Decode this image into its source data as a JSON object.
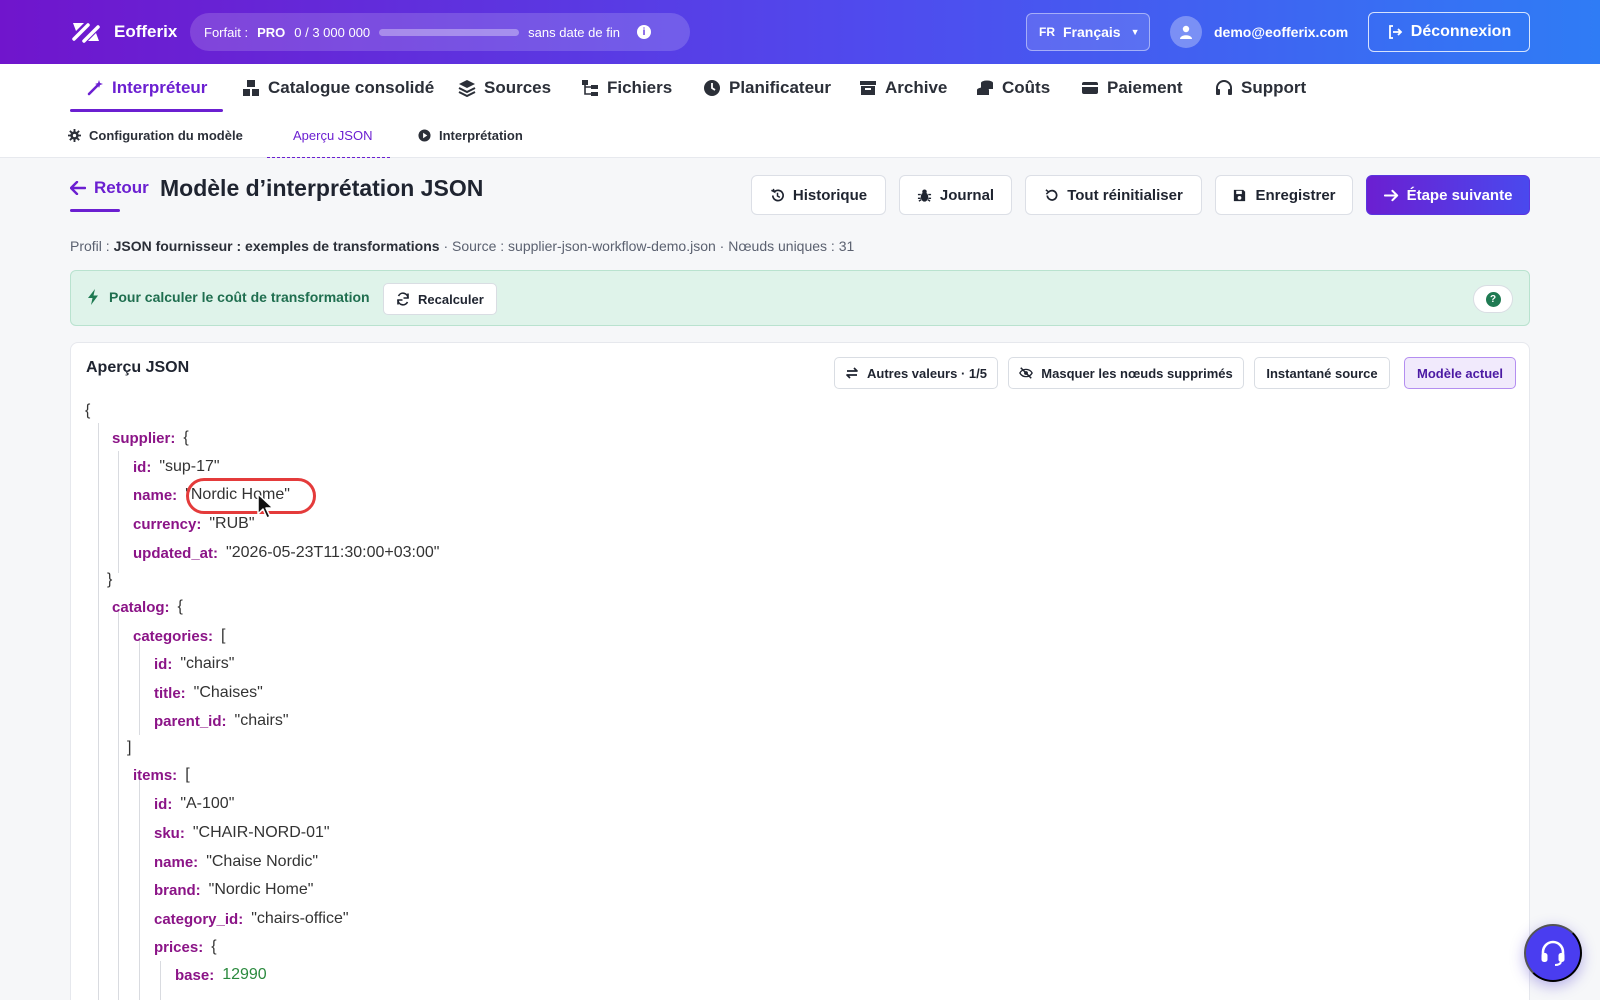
{
  "app": {
    "name": "Eofferix"
  },
  "plan": {
    "label": "Forfait :",
    "tier": "PRO",
    "usage": "0 / 3 000 000",
    "usage_fraction": 0,
    "expiry": "sans date de fin",
    "info_icon": "info-icon"
  },
  "language": {
    "code": "FR",
    "name": "Français"
  },
  "user": {
    "email": "demo@eofferix.com"
  },
  "logout_label": "Déconnexion",
  "nav": {
    "items": [
      {
        "label": "Interpréteur",
        "icon": "magic-wand-icon",
        "active": true
      },
      {
        "label": "Catalogue consolidé",
        "icon": "cubes-icon"
      },
      {
        "label": "Sources",
        "icon": "layers-icon"
      },
      {
        "label": "Fichiers",
        "icon": "folder-tree-icon"
      },
      {
        "label": "Planificateur",
        "icon": "clock-icon"
      },
      {
        "label": "Archive",
        "icon": "archive-icon"
      },
      {
        "label": "Coûts",
        "icon": "coins-icon"
      },
      {
        "label": "Paiement",
        "icon": "credit-card-icon"
      },
      {
        "label": "Support",
        "icon": "headset-icon"
      }
    ]
  },
  "subnav": {
    "items": [
      {
        "label": "Configuration du modèle",
        "icon": "gear-icon"
      },
      {
        "label": "Aperçu JSON",
        "active": true
      },
      {
        "label": "Interprétation",
        "icon": "play-circle-icon"
      }
    ]
  },
  "header": {
    "back_label": "Retour",
    "title": "Modèle d’interprétation JSON",
    "buttons": {
      "history": "Historique",
      "journal": "Journal",
      "reset": "Tout réinitialiser",
      "save": "Enregistrer",
      "next": "Étape suivante"
    }
  },
  "profile": {
    "prefix": "Profil :",
    "name": "JSON fournisseur : exemples de transformations",
    "rest": "· Source : supplier-json-workflow-demo.json · Nœuds uniques : 31"
  },
  "banner": {
    "text": "Pour calculer le coût de transformation",
    "recalc_label": "Recalculer",
    "help": "?"
  },
  "preview": {
    "title": "Aperçu JSON",
    "buttons": {
      "other_values": "Autres valeurs · 1/5",
      "hide_deleted": "Masquer les nœuds supprimés",
      "source_snapshot": "Instantané source",
      "current_model": "Modèle actuel"
    },
    "lines": [
      {
        "text": "{"
      },
      {
        "key": "supplier:",
        "value": "{"
      },
      {
        "key": "id:",
        "value": "\"sup-17\""
      },
      {
        "key": "name:",
        "value": "\"Nordic Home\""
      },
      {
        "key": "currency:",
        "value": "\"RUB\""
      },
      {
        "key": "updated_at:",
        "value": "\"2026-05-23T11:30:00+03:00\""
      },
      {
        "text": "}"
      },
      {
        "key": "catalog:",
        "value": "{"
      },
      {
        "key": "categories:",
        "value": "["
      },
      {
        "key": "id:",
        "value": "\"chairs\""
      },
      {
        "key": "title:",
        "value": "\"Chaises\""
      },
      {
        "key": "parent_id:",
        "value": "\"chairs\""
      },
      {
        "text": "]"
      },
      {
        "key": "items:",
        "value": "["
      },
      {
        "key": "id:",
        "value": "\"A-100\""
      },
      {
        "key": "sku:",
        "value": "\"CHAIR-NORD-01\""
      },
      {
        "key": "name:",
        "value": "\"Chaise Nordic\""
      },
      {
        "key": "brand:",
        "value": "\"Nordic Home\""
      },
      {
        "key": "category_id:",
        "value": "\"chairs-office\""
      },
      {
        "key": "prices:",
        "value": "{"
      },
      {
        "key": "base:",
        "value": "12990"
      }
    ]
  },
  "colors": {
    "accent": "#6b1fd1",
    "banner_bg": "#dff3ea",
    "highlight": "#e43b3b",
    "number": "#2b8a3e"
  }
}
